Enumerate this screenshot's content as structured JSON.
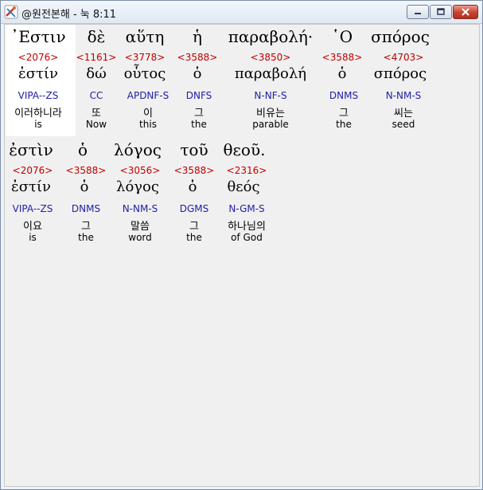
{
  "window": {
    "title": "@원전본해 - 눅 8:11",
    "minimize_label": "minimize",
    "maximize_label": "maximize",
    "close_label": "close"
  },
  "rows": [
    {
      "words": [
        {
          "greek": "᾿Εστιν",
          "strong": "<2076>",
          "lemma": "ἐστίν",
          "parse": "VIPA--ZS",
          "korean": "이러하니라",
          "english": "is"
        },
        {
          "greek": "δὲ",
          "strong": "<1161>",
          "lemma": "δώ",
          "parse": "CC",
          "korean": "또",
          "english": "Now"
        },
        {
          "greek": "αὕτη",
          "strong": "<3778>",
          "lemma": "οὗτος",
          "parse": "APDNF-S",
          "korean": "이",
          "english": "this"
        },
        {
          "greek": "ἡ",
          "strong": "<3588>",
          "lemma": "ὁ",
          "parse": "DNFS",
          "korean": "그",
          "english": "the"
        },
        {
          "greek": "παραβολή·",
          "strong": "<3850>",
          "lemma": "παραβολή",
          "parse": "N-NF-S",
          "korean": "비유는",
          "english": "parable"
        },
        {
          "greek": "῾Ο",
          "strong": "<3588>",
          "lemma": "ὁ",
          "parse": "DNMS",
          "korean": "그",
          "english": "the"
        },
        {
          "greek": "σπόρος",
          "strong": "<4703>",
          "lemma": "σπόρος",
          "parse": "N-NM-S",
          "korean": "씨는",
          "english": "seed"
        }
      ]
    },
    {
      "words": [
        {
          "greek": "ἐστὶν",
          "strong": "<2076>",
          "lemma": "ἐστίν",
          "parse": "VIPA--ZS",
          "korean": "이요",
          "english": "is"
        },
        {
          "greek": "ὁ",
          "strong": "<3588>",
          "lemma": "ὁ",
          "parse": "DNMS",
          "korean": "그",
          "english": "the"
        },
        {
          "greek": "λόγος",
          "strong": "<3056>",
          "lemma": "λόγος",
          "parse": "N-NM-S",
          "korean": "말씀",
          "english": "word"
        },
        {
          "greek": "τοῦ",
          "strong": "<3588>",
          "lemma": "ὁ",
          "parse": "DGMS",
          "korean": "그",
          "english": "the"
        },
        {
          "greek": "θεοῦ.",
          "strong": "<2316>",
          "lemma": "θεός",
          "parse": "N-GM-S",
          "korean": "하나님의",
          "english": "of God"
        }
      ]
    }
  ],
  "colors": {
    "strong": "#c00000",
    "parse": "#2020a8",
    "highlight": "#ffffff"
  }
}
